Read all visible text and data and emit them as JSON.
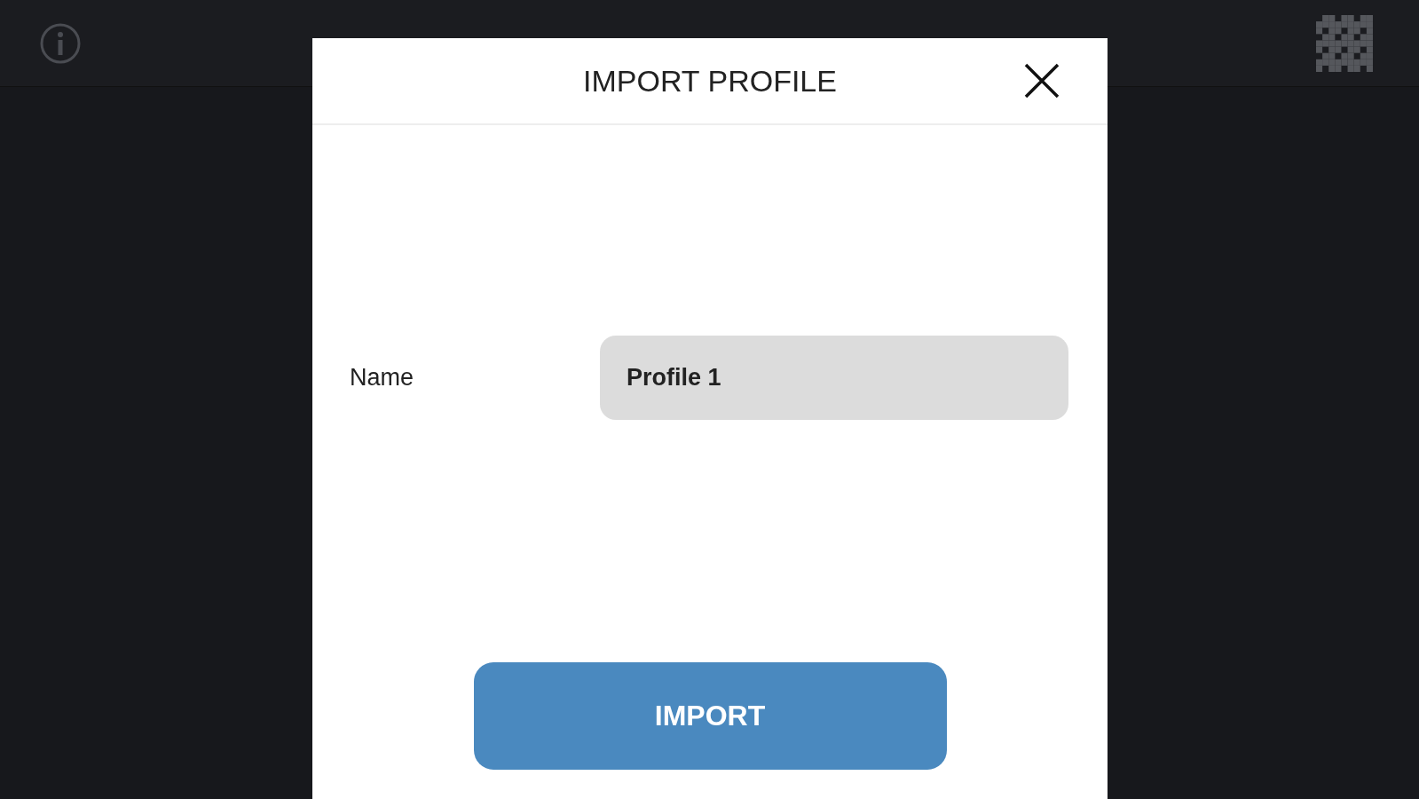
{
  "dialog": {
    "title": "IMPORT PROFILE",
    "fields": [
      {
        "label": "Name",
        "value": "Profile 1"
      }
    ],
    "button": "IMPORT"
  }
}
